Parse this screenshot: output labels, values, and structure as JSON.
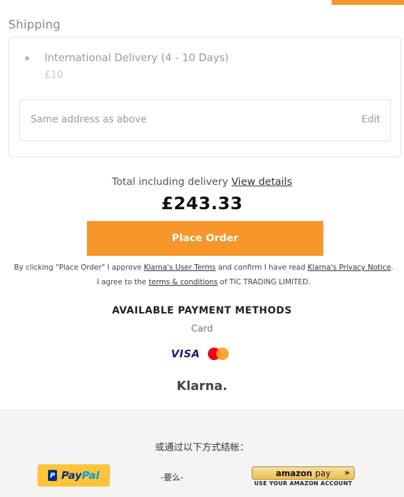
{
  "shipping": {
    "title": "Shipping",
    "option_label": "International Delivery (4 - 10 Days)",
    "option_price": "£10",
    "address_text": "Same address as above",
    "edit_label": "Edit"
  },
  "total": {
    "label": "Total including delivery",
    "view_details": "View details",
    "amount": "£243.33"
  },
  "place_order_label": "Place Order",
  "legal": {
    "part1": "By clicking \"Place Order\" I approve",
    "klarna_terms": "Klarna's User Terms",
    "part2": "and confirm I have read",
    "klarna_privacy": "Klarna's Privacy Notice",
    "part3": ". I agree to the",
    "terms_link": "terms & conditions",
    "part4": "of TIC TRADING LIMITED."
  },
  "payment_methods": {
    "title": "AVAILABLE PAYMENT METHODS",
    "card_label": "Card",
    "visa": "VISA",
    "klarna": "Klarna."
  },
  "alternative": {
    "title": "或通过以下方式结帐：",
    "paypal_pay": "Pay",
    "paypal_pal": "Pal",
    "paypal_icon_letter": "P",
    "or_text": "-要么-",
    "amazon_brand": "amazon",
    "amazon_pay": "pay",
    "amazon_arrows": "»",
    "amazon_sub": "USE YOUR AMAZON ACCOUNT"
  },
  "colors": {
    "accent": "#f7962a",
    "visa": "#1a1f71",
    "mastercard_red": "#eb001b",
    "mastercard_yellow": "#f79e1b",
    "paypal_yellow": "#ffc439",
    "paypal_blue": "#003087"
  }
}
